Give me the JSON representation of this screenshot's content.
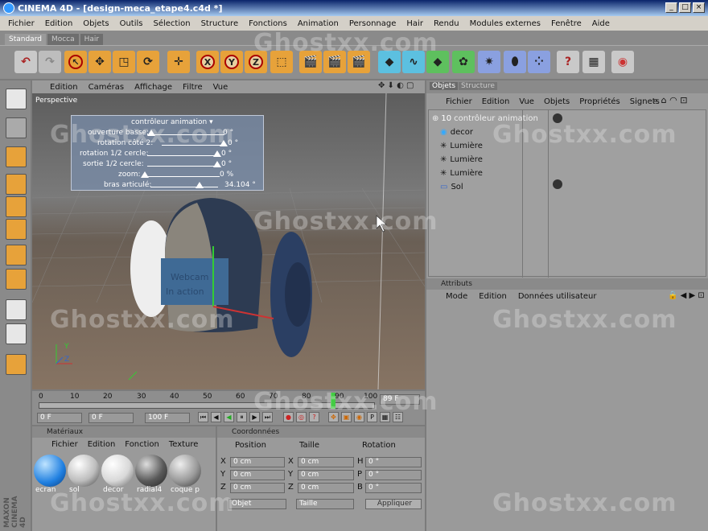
{
  "window": {
    "title": "CINEMA 4D - [design-meca_etape4.c4d *]",
    "min": "_",
    "max": "□",
    "close": "×"
  },
  "menu": [
    "Fichier",
    "Edition",
    "Objets",
    "Outils",
    "Sélection",
    "Structure",
    "Fonctions",
    "Animation",
    "Personnage",
    "Hair",
    "Rendu",
    "Modules externes",
    "Fenêtre",
    "Aide"
  ],
  "layout_tabs": [
    "Standard",
    "Mocca",
    "Hair"
  ],
  "viewport": {
    "menu": [
      "Edition",
      "Caméras",
      "Affichage",
      "Filtre",
      "Vue"
    ],
    "label": "Perspective",
    "hud": {
      "title": "contrôleur animation",
      "rows": [
        {
          "label": "ouverture basse:",
          "value": "0 °"
        },
        {
          "label": "rotation côté 2:",
          "value": "0 °"
        },
        {
          "label": "rotation 1/2 cercle:",
          "value": "0 °"
        },
        {
          "label": "sortie 1/2 cercle:",
          "value": "0 °"
        },
        {
          "label": "zoom:",
          "value": "0 %"
        },
        {
          "label": "bras articulé:",
          "value": "34.104 °"
        }
      ]
    },
    "screen_text": "Webcam\nIn action",
    "axis": {
      "y": "Y",
      "z": "Z"
    }
  },
  "timeline": {
    "ticks": [
      "0",
      "10",
      "20",
      "30",
      "40",
      "50",
      "60",
      "70",
      "80",
      "90",
      "100"
    ],
    "current": "89 F",
    "start": "0 F",
    "preview": "0 F",
    "end": "100 F"
  },
  "objects": {
    "tabs": [
      "Objets",
      "Structure"
    ],
    "menu": [
      "Fichier",
      "Edition",
      "Vue",
      "Objets",
      "Propriétés",
      "Signets"
    ],
    "items": [
      {
        "name": "contrôleur animation",
        "prefix": "10"
      },
      {
        "name": "decor",
        "prefix": ""
      },
      {
        "name": "Lumière",
        "prefix": ""
      },
      {
        "name": "Lumière",
        "prefix": ""
      },
      {
        "name": "Lumière",
        "prefix": ""
      },
      {
        "name": "Sol",
        "prefix": ""
      }
    ]
  },
  "attributes": {
    "title": "Attributs",
    "menu": [
      "Mode",
      "Edition",
      "Données utilisateur"
    ]
  },
  "materials": {
    "title": "Matériaux",
    "menu": [
      "Fichier",
      "Edition",
      "Fonction",
      "Texture"
    ],
    "items": [
      {
        "name": "ecran",
        "color": "#1f7fe0"
      },
      {
        "name": "sol",
        "color": "#bdbdbd"
      },
      {
        "name": "decor",
        "color": "#d8d8d8"
      },
      {
        "name": "radial4",
        "color": "#5a5a5a"
      },
      {
        "name": "coque p",
        "color": "#9a9a9a"
      }
    ]
  },
  "coords": {
    "title": "Coordonnées",
    "headers": [
      "Position",
      "Taille",
      "Rotation"
    ],
    "rows": [
      {
        "a": "X",
        "av": "0 cm",
        "b": "X",
        "bv": "0 cm",
        "c": "H",
        "cv": "0 °"
      },
      {
        "a": "Y",
        "av": "0 cm",
        "b": "Y",
        "bv": "0 cm",
        "c": "P",
        "cv": "0 °"
      },
      {
        "a": "Z",
        "av": "0 cm",
        "b": "Z",
        "bv": "0 cm",
        "c": "B",
        "cv": "0 °"
      }
    ],
    "mode1": "Objet",
    "mode2": "Taille",
    "apply": "Appliquer"
  },
  "brand": "MAXON CINEMA 4D",
  "watermark": "Ghostxx.com"
}
